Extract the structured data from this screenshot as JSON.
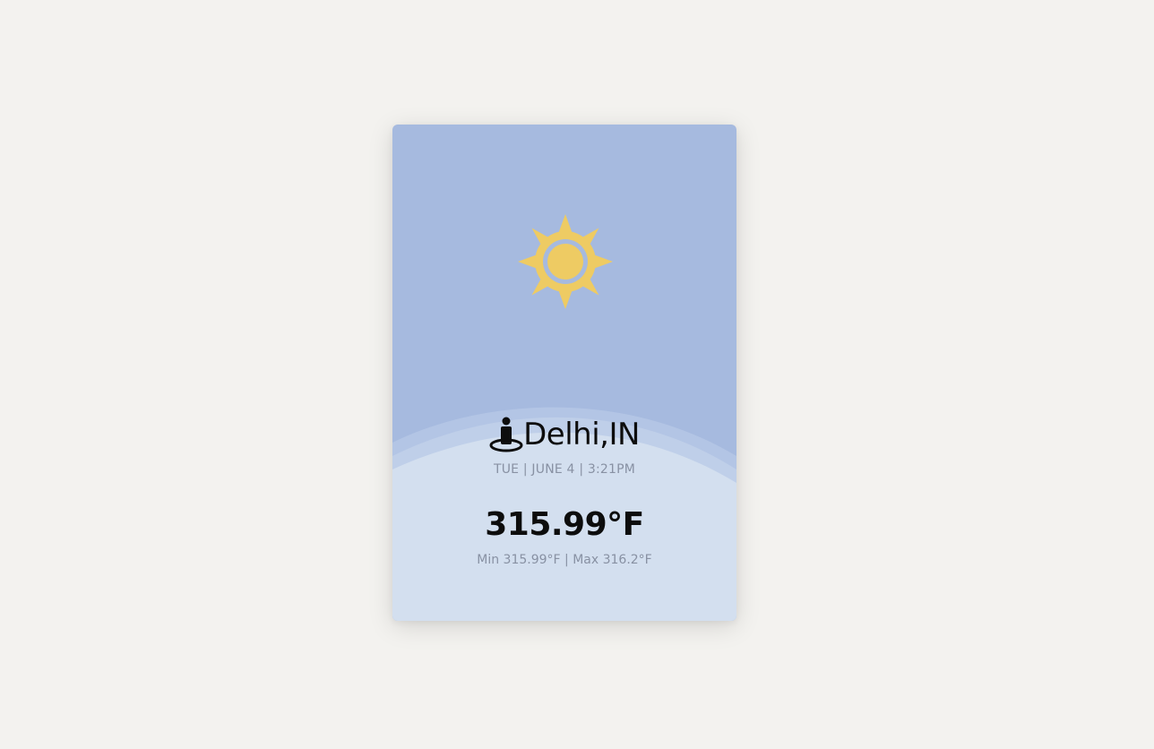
{
  "weather": {
    "icon": "sun-icon",
    "location": "Delhi,IN",
    "datetime": "TUE | JUNE 4 | 3:21PM",
    "temperature": "315.99°F",
    "min_max": "Min 315.99°F | Max 316.2°F"
  },
  "colors": {
    "background": "#f3f2ef",
    "card_top": "#a6badf",
    "card_bottom": "#d3dfef",
    "sun": "#eecb63",
    "muted_text": "#8891a3"
  }
}
